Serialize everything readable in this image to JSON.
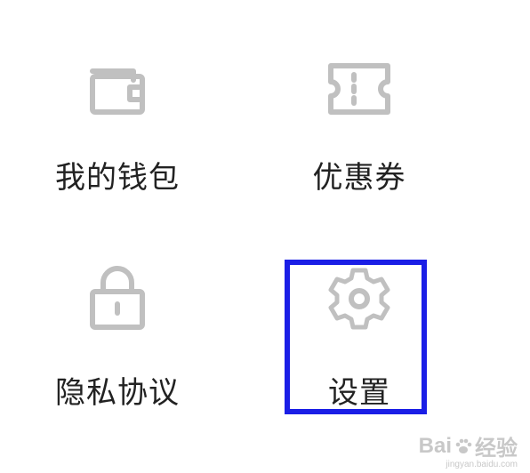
{
  "menu": {
    "items": [
      {
        "label": "我的钱包",
        "icon": "wallet-icon"
      },
      {
        "label": "优惠券",
        "icon": "ticket-icon"
      },
      {
        "label": "隐私协议",
        "icon": "lock-icon"
      },
      {
        "label": "设置",
        "icon": "gear-icon"
      }
    ]
  },
  "colors": {
    "icon": "#c0c0c0",
    "label": "#222222",
    "highlight": "#1a1ee6"
  },
  "watermark": {
    "brand_left": "Bai",
    "brand_right": "经验",
    "url": "jingyan.baidu.com"
  }
}
